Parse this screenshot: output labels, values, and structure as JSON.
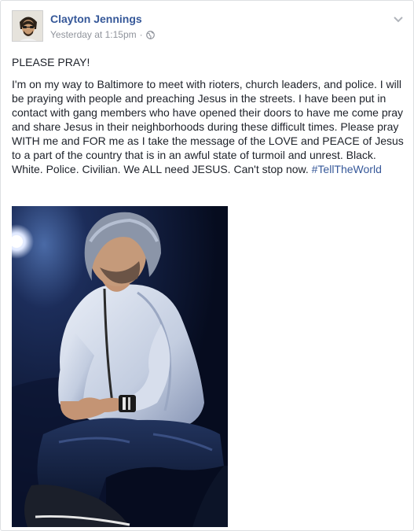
{
  "post": {
    "author": "Clayton Jennings",
    "timestamp": "Yesterday at 1:15pm",
    "separator": "·",
    "privacy_icon": "globe-icon",
    "options_icon": "chevron-down-icon",
    "title": "PLEASE PRAY!",
    "body": "I'm on my way to Baltimore to meet with rioters, church leaders, and police. I will be praying with people and preaching Jesus in the streets. I have been put in contact with gang members who have opened their doors to have me come pray and share Jesus in their neighborhoods during these difficult times. Please pray WITH me and FOR me as I take the message of the LOVE and PEACE of Jesus to a part of the country that is in an awful state of turmoil and unrest. Black. White. Police. Civilian. We ALL need JESUS. Can't stop now.",
    "hashtag": "#TellTheWorld"
  },
  "colors": {
    "link": "#365899",
    "text": "#1d2129",
    "meta": "#90949c"
  }
}
